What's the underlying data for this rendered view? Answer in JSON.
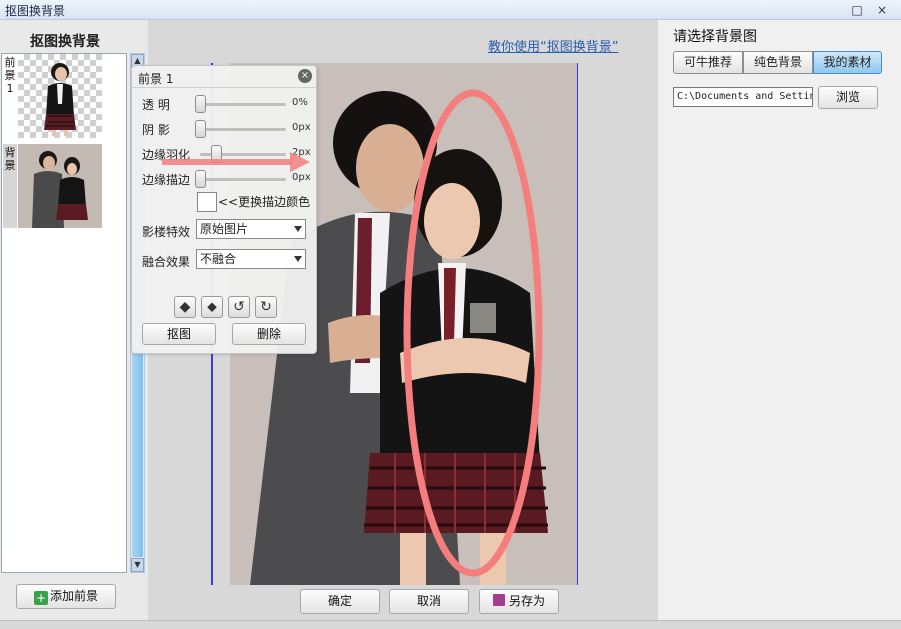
{
  "window": {
    "title": "抠图换背景",
    "minimize_glyph": "□",
    "close_glyph": "×"
  },
  "left_panel": {
    "heading": "抠图换背景",
    "items": [
      {
        "side_label": "前景 1",
        "kind": "foreground-cutout"
      },
      {
        "side_label": "背景",
        "kind": "background-photo"
      }
    ],
    "add_foreground_label": "添加前景"
  },
  "canvas": {
    "help_link": "教你使用“抠图换背景”",
    "highlight_color": "#f47e7e",
    "guide_color": "#3c3cd6"
  },
  "props_panel": {
    "title": "前景 1",
    "sliders": [
      {
        "label": "透    明",
        "value": "0%",
        "level": 0
      },
      {
        "label": "阴    影",
        "value": "0px",
        "level": 0
      },
      {
        "label": "边缘羽化",
        "value": "2px",
        "level": 0.18
      },
      {
        "label": "边缘描边",
        "value": "0px",
        "level": 0
      }
    ],
    "stroke_color_button": "<<更换描边颜色",
    "effect_label": "影楼特效",
    "effect_value": "原始图片",
    "blend_label": "融合效果",
    "blend_value": "不融合",
    "icon_buttons": [
      "flip-horizontal-icon",
      "flip-vertical-icon",
      "rotate-left-icon",
      "rotate-right-icon"
    ],
    "cutout_button": "抠图",
    "delete_button": "删除"
  },
  "right_panel": {
    "title": "请选择背景图",
    "tabs": [
      {
        "label": "可牛推荐",
        "active": false
      },
      {
        "label": "纯色背景",
        "active": false
      },
      {
        "label": "我的素材",
        "active": true
      }
    ],
    "path_value": "C:\\Documents and Settin",
    "browse_label": "浏览"
  },
  "bottom_buttons": {
    "ok": "确定",
    "cancel": "取消",
    "save_as": "另存为"
  }
}
